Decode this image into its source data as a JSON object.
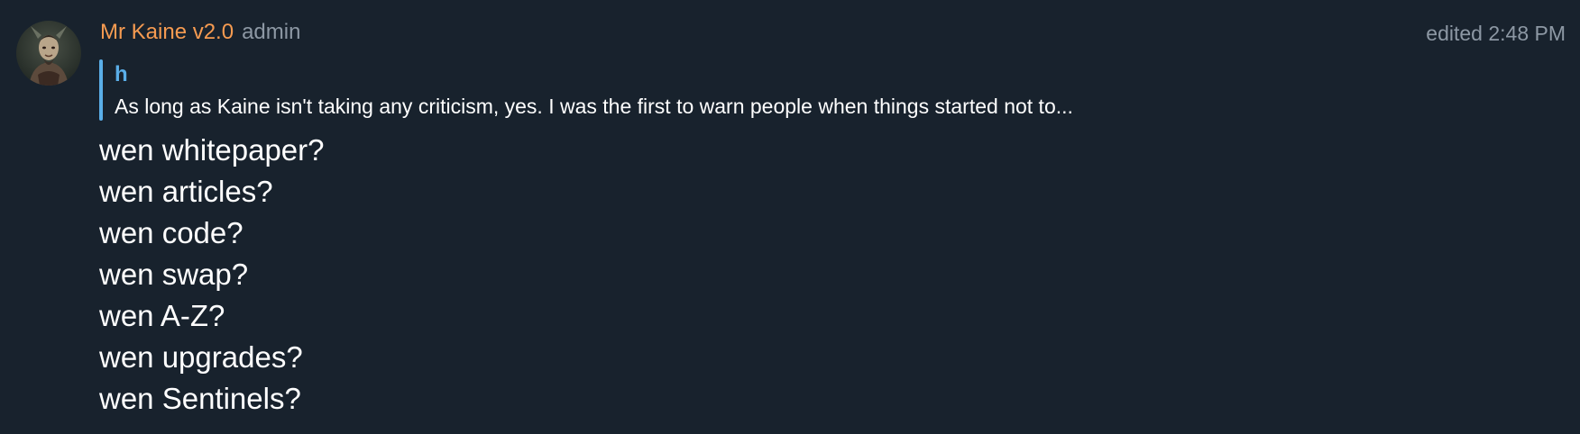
{
  "message": {
    "author": "Mr Kaine v2.0",
    "role_badge": "admin",
    "edited_label": "edited",
    "time": "2:48 PM",
    "reply": {
      "author": "h",
      "snippet": "As long as Kaine isn't taking any criticism, yes. I was the first to warn people when things started not to..."
    },
    "lines": [
      "wen whitepaper?",
      "wen articles?",
      "wen code?",
      "wen swap?",
      "wen A-Z?",
      "wen upgrades?",
      "wen Sentinels?"
    ]
  },
  "colors": {
    "background": "#18222d",
    "author": "#f69b51",
    "reply_accent": "#5aaee8",
    "muted": "#8d98a4",
    "text": "#ffffff"
  },
  "icons": {
    "avatar": "user-avatar"
  }
}
